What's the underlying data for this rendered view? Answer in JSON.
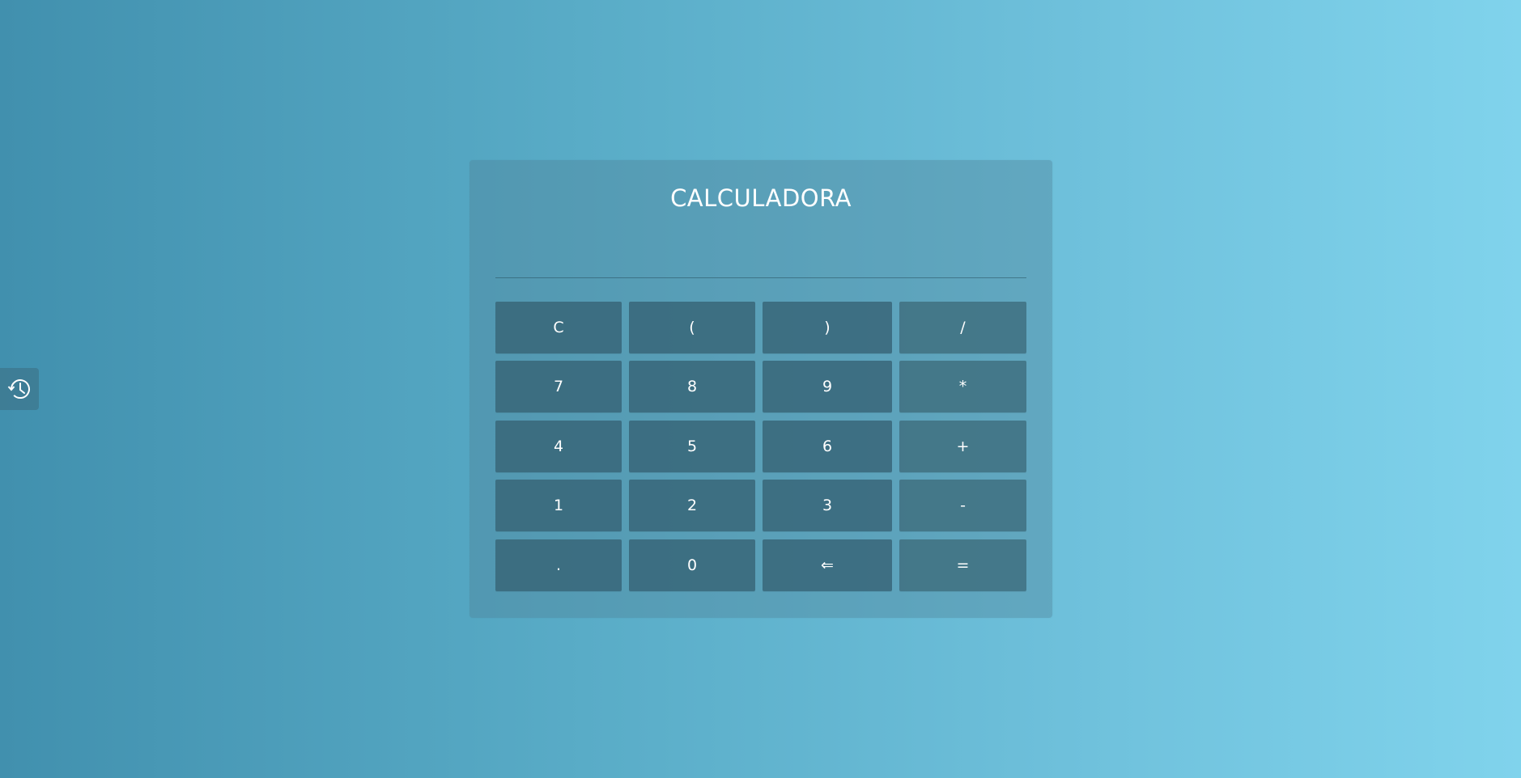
{
  "calculator": {
    "title": "CALCULADORA",
    "display_value": "",
    "keys": [
      [
        "C",
        "(",
        ")",
        "/"
      ],
      [
        "7",
        "8",
        "9",
        "*"
      ],
      [
        "4",
        "5",
        "6",
        "+"
      ],
      [
        "1",
        "2",
        "3",
        "-"
      ],
      [
        ".",
        "0",
        "⇐",
        "="
      ]
    ]
  },
  "history": {
    "icon": "history-icon"
  },
  "colors": {
    "background_start": "#4190ae",
    "background_end": "#80d3ec",
    "key": "#3c6e80",
    "text": "#ffffff"
  }
}
